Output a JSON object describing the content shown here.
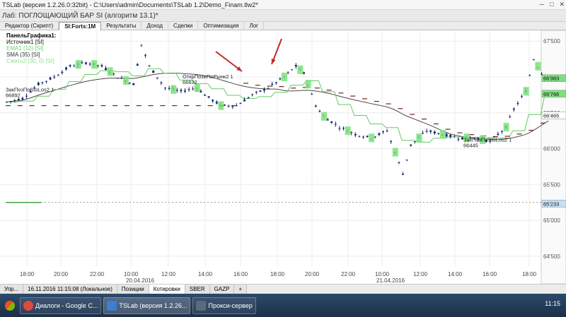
{
  "window": {
    "title": "TSLab (версия 1.2.26.0:32bit) - C:\\Users\\admin\\Documents\\TSLab 1.2\\Demo_Finam.tlw2*"
  },
  "document": {
    "title": "Лаб: ПОГЛОЩАЮЩИЙ БАР SI   (алгоритм 13.1)*"
  },
  "tabs": [
    {
      "label": "Редактор (Скрипт)"
    },
    {
      "label": "SI:Forts:1M",
      "active": true
    },
    {
      "label": "Результаты"
    },
    {
      "label": "Доход"
    },
    {
      "label": "Сделки"
    },
    {
      "label": "Оптимизация"
    },
    {
      "label": "Лог"
    }
  ],
  "legend": {
    "title": "ПанельГрафика1:",
    "items": [
      {
        "label": "Источник1 [SI]",
        "color": "#111111"
      },
      {
        "label": "EMA1 (10) [SI]",
        "color": "#6ad46a"
      },
      {
        "label": "SMA (35) [SI]",
        "color": "#333333"
      },
      {
        "label": "Сжать2 (30, 0) [SI]",
        "color": "#8ee08e"
      }
    ]
  },
  "annotations": [
    {
      "label": "ЗакПозПоStoLos2 1",
      "price": "66892"
    },
    {
      "label": "ОткрПозиПоРынк2 1",
      "price": "66632"
    },
    {
      "label": "ЗакПозПоStoLos2 1",
      "price": "66445"
    }
  ],
  "chart_data": {
    "type": "candlestick",
    "y_ticks": [
      "67'500",
      "67'000",
      "66'500",
      "66'000",
      "65'500",
      "65'000",
      "64'500"
    ],
    "ylim": [
      64400,
      67650
    ],
    "x_ticks": [
      "18:00",
      "20:00",
      "22:00",
      "10:00",
      "12:00",
      "14:00",
      "16:00",
      "18:00",
      "20:00",
      "22:00",
      "10:00",
      "12:00",
      "14:00",
      "16:00",
      "18:00"
    ],
    "date_labels": [
      "20.04.2016",
      "21.04.2016"
    ],
    "right_badges": [
      "66'983",
      "66'766",
      "66'465",
      "65'233"
    ],
    "price_path": [
      [
        0,
        66650
      ],
      [
        4,
        66700
      ],
      [
        8,
        66900
      ],
      [
        12,
        67000
      ],
      [
        16,
        67150
      ],
      [
        20,
        67200
      ],
      [
        24,
        67150
      ],
      [
        28,
        67000
      ],
      [
        32,
        66900
      ],
      [
        34,
        67450
      ],
      [
        36,
        67150
      ],
      [
        40,
        66850
      ],
      [
        44,
        66800
      ],
      [
        48,
        66850
      ],
      [
        50,
        66750
      ],
      [
        54,
        66600
      ],
      [
        58,
        66600
      ],
      [
        62,
        66750
      ],
      [
        66,
        66850
      ],
      [
        70,
        67000
      ],
      [
        73,
        67150
      ],
      [
        75,
        67050
      ],
      [
        76,
        66900
      ],
      [
        78,
        66600
      ],
      [
        80,
        66450
      ],
      [
        84,
        66300
      ],
      [
        88,
        66200
      ],
      [
        92,
        66150
      ],
      [
        96,
        66250
      ],
      [
        98,
        65950
      ],
      [
        100,
        65650
      ],
      [
        102,
        66050
      ],
      [
        106,
        66250
      ],
      [
        110,
        66200
      ],
      [
        114,
        66150
      ],
      [
        118,
        66150
      ],
      [
        122,
        66100
      ],
      [
        126,
        66300
      ],
      [
        128,
        66550
      ],
      [
        131,
        66800
      ],
      [
        133,
        67250
      ],
      [
        135,
        67050
      ],
      [
        137,
        67000
      ]
    ]
  },
  "bottom_tabs": [
    {
      "label": "Упр..."
    },
    {
      "label": "16.11.2016 11:15:08 (Локальное)"
    },
    {
      "label": "Позиции"
    },
    {
      "label": "Котировки"
    },
    {
      "label": "SBER"
    },
    {
      "label": "GAZP"
    },
    {
      "label": "+"
    }
  ],
  "taskbar": {
    "items": [
      {
        "label": "Диалоги - Google C...",
        "icon_color": "#e04a3a"
      },
      {
        "label": "TSLab (версия 1.2.26...",
        "icon_color": "#3a7fd0"
      },
      {
        "label": "Прокси-сервер",
        "icon_color": "#5a6a7a"
      }
    ],
    "clock": "11:15"
  }
}
